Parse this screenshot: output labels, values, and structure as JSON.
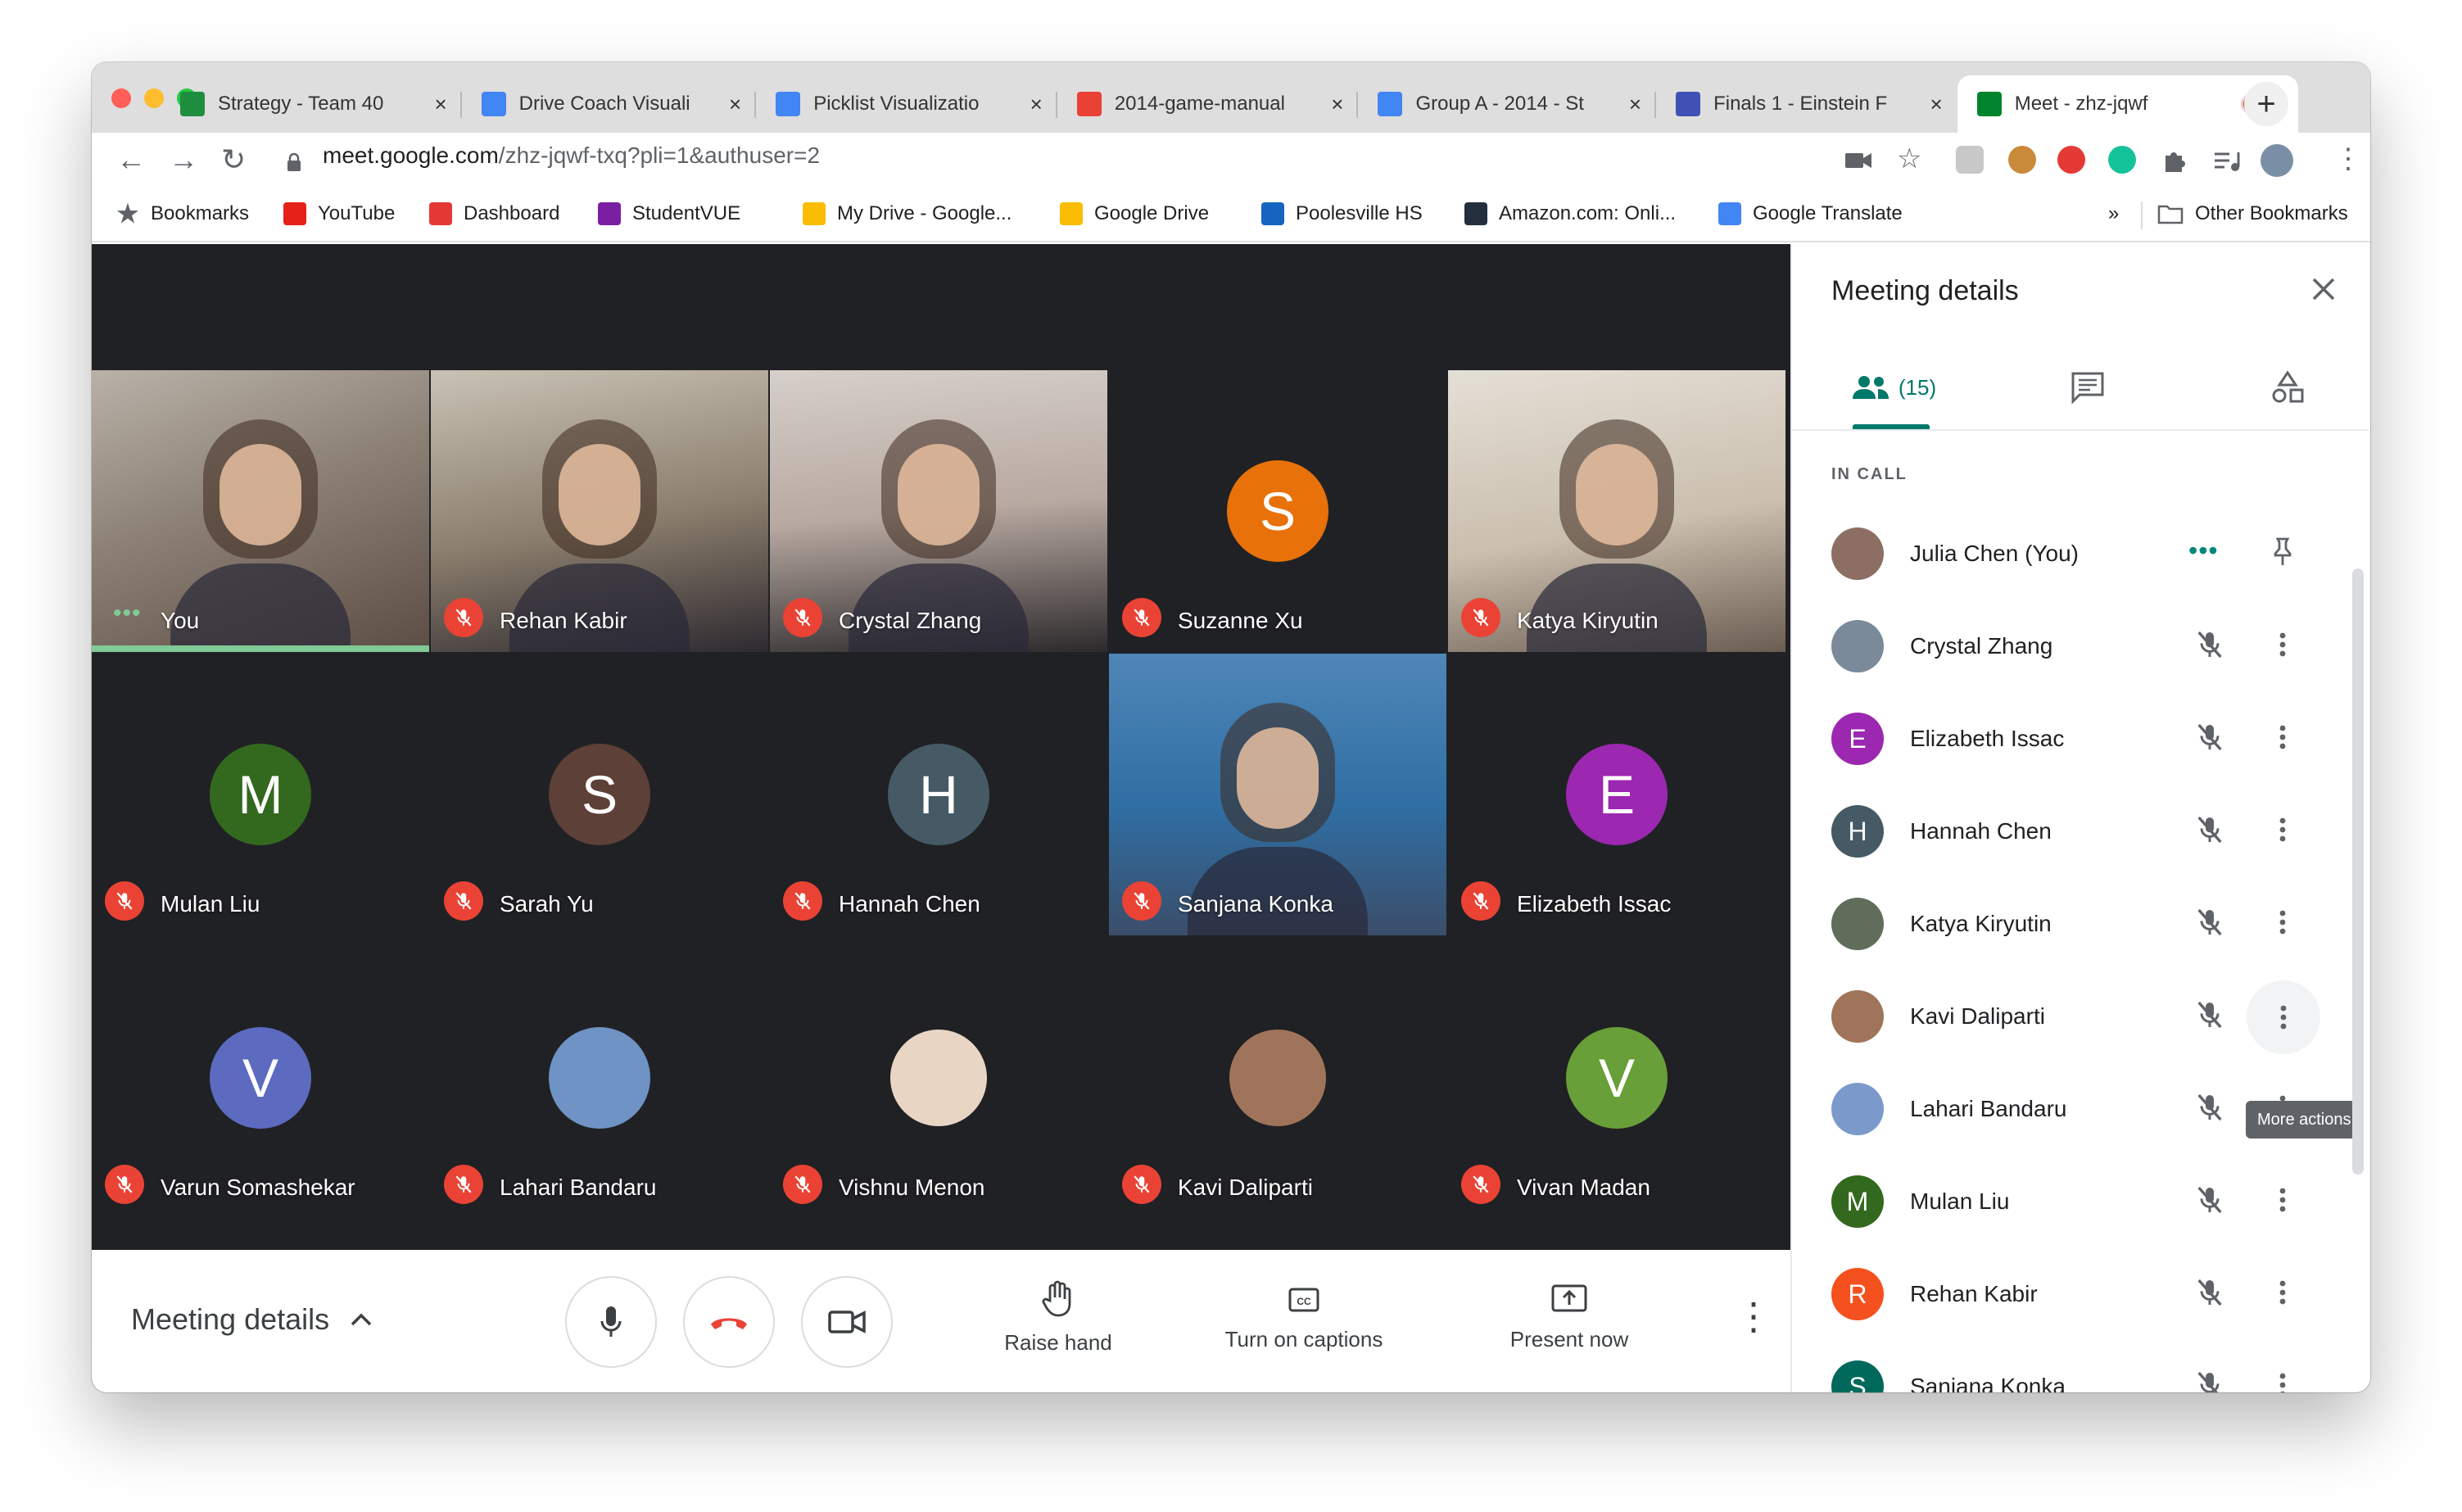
{
  "browser": {
    "tabs": [
      {
        "title": "Strategy - Team 40",
        "icon_color": "#1e8e3e"
      },
      {
        "title": "Drive Coach Visuali",
        "icon_color": "#4285f4"
      },
      {
        "title": "Picklist Visualizatio",
        "icon_color": "#4285f4"
      },
      {
        "title": "2014-game-manual",
        "icon_color": "#e94235"
      },
      {
        "title": "Group A - 2014 - St",
        "icon_color": "#4285f4"
      },
      {
        "title": "Finals 1 - Einstein F",
        "icon_color": "#3f51b5"
      },
      {
        "title": "Meet - zhz-jqwf",
        "icon_color": "#00832d"
      }
    ],
    "new_tab_label": "+",
    "close_glyph": "×",
    "url_host": "meet.google.com",
    "url_path": "/zhz-jqwf-txq?pli=1&authuser=2",
    "bookmarks": [
      {
        "label": "Bookmarks",
        "icon": "star-icon"
      },
      {
        "label": "YouTube",
        "icon": "youtube-icon"
      },
      {
        "label": "Dashboard",
        "icon": "dashboard-icon"
      },
      {
        "label": "StudentVUE",
        "icon": "studentvue-icon"
      },
      {
        "label": "My Drive - Google...",
        "icon": "drive-icon"
      },
      {
        "label": "Google Drive",
        "icon": "drive-icon"
      },
      {
        "label": "Poolesville HS",
        "icon": "school-icon"
      },
      {
        "label": "Amazon.com: Onli...",
        "icon": "amazon-icon"
      },
      {
        "label": "Google Translate",
        "icon": "translate-icon"
      }
    ],
    "bookmarks_overflow": "»",
    "other_bookmarks": "Other Bookmarks"
  },
  "participants_grid": [
    {
      "name": "You",
      "type": "video",
      "speaking": true
    },
    {
      "name": "Rehan Kabir",
      "type": "video"
    },
    {
      "name": "Crystal Zhang",
      "type": "video"
    },
    {
      "name": "Suzanne Xu",
      "type": "avatar",
      "initial": "S",
      "color": "#e8710a"
    },
    {
      "name": "Katya Kiryutin",
      "type": "video"
    },
    {
      "name": "Mulan Liu",
      "type": "avatar",
      "initial": "M",
      "color": "#33691e"
    },
    {
      "name": "Sarah Yu",
      "type": "avatar",
      "initial": "S",
      "color": "#5d4037"
    },
    {
      "name": "Hannah Chen",
      "type": "avatar",
      "initial": "H",
      "color": "#455a64"
    },
    {
      "name": "Sanjana Konka",
      "type": "video"
    },
    {
      "name": "Elizabeth Issac",
      "type": "avatar",
      "initial": "E",
      "color": "#9c27b0"
    },
    {
      "name": "Varun Somashekar",
      "type": "avatar",
      "initial": "V",
      "color": "#5c6bc0"
    },
    {
      "name": "Lahari Bandaru",
      "type": "avatar",
      "initial": "",
      "color": "#6e93c4"
    },
    {
      "name": "Vishnu Menon",
      "type": "photo",
      "color": "#e8d5c4"
    },
    {
      "name": "Kavi Daliparti",
      "type": "photo",
      "color": "#a0745a"
    },
    {
      "name": "Vivan Madan",
      "type": "avatar",
      "initial": "V",
      "color": "#689f38"
    }
  ],
  "controls": {
    "meeting_details": "Meeting details",
    "raise_hand": "Raise hand",
    "captions": "Turn on captions",
    "present": "Present now"
  },
  "panel": {
    "title": "Meeting details",
    "people_count": "(15)",
    "in_call": "IN CALL",
    "more_actions_tooltip": "More actions",
    "people": [
      {
        "name": "Julia Chen (You)",
        "initial": "",
        "color": "#8d6e63",
        "self": true
      },
      {
        "name": "Crystal Zhang",
        "initial": "",
        "color": "#7a8a9a"
      },
      {
        "name": "Elizabeth Issac",
        "initial": "E",
        "color": "#9c27b0"
      },
      {
        "name": "Hannah Chen",
        "initial": "H",
        "color": "#455a64"
      },
      {
        "name": "Katya Kiryutin",
        "initial": "",
        "color": "#5f6d5a"
      },
      {
        "name": "Kavi Daliparti",
        "initial": "",
        "color": "#a0745a"
      },
      {
        "name": "Lahari Bandaru",
        "initial": "",
        "color": "#7b9acb"
      },
      {
        "name": "Mulan Liu",
        "initial": "M",
        "color": "#33691e"
      },
      {
        "name": "Rehan Kabir",
        "initial": "R",
        "color": "#f4511e"
      },
      {
        "name": "Sanjana Konka",
        "initial": "S",
        "color": "#00695c"
      }
    ]
  }
}
